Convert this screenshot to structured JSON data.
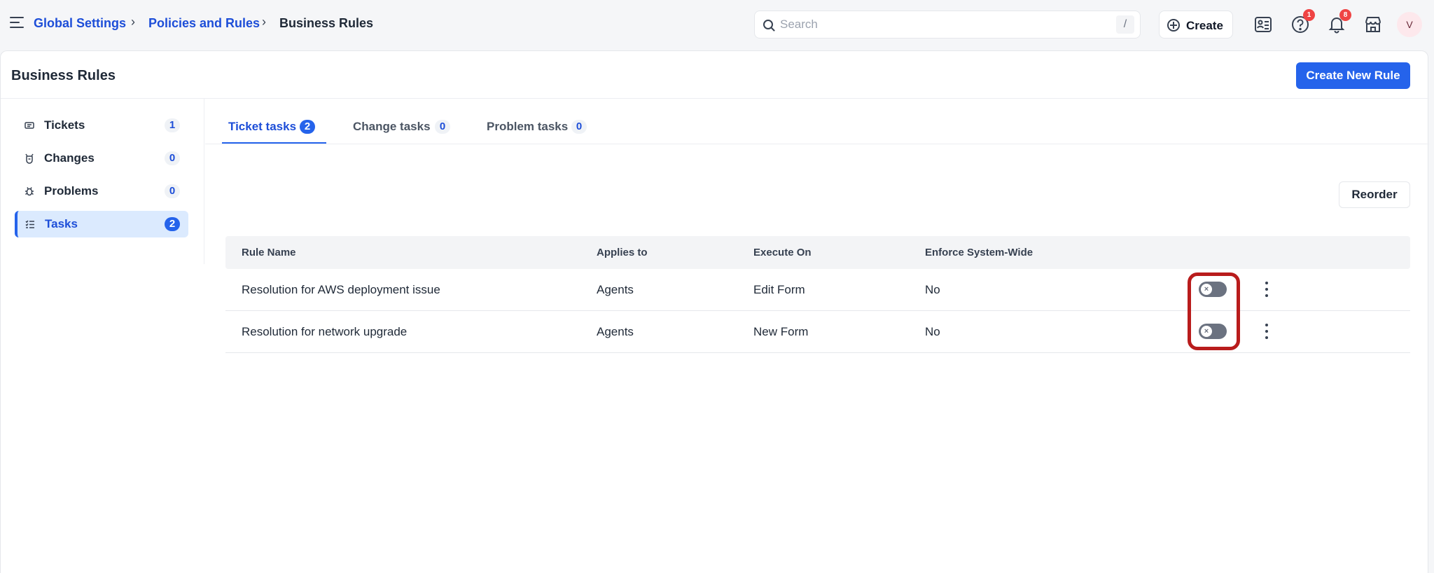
{
  "breadcrumb": {
    "items": [
      {
        "label": "Global Settings"
      },
      {
        "label": "Policies and Rules"
      },
      {
        "label": "Business Rules"
      }
    ],
    "separator": "›"
  },
  "search": {
    "placeholder": "Search",
    "shortcut": "/"
  },
  "header_actions": {
    "create_label": "Create",
    "help_badge": "1",
    "notifications_badge": "8",
    "avatar_initial": "V"
  },
  "page": {
    "title": "Business Rules",
    "primary_action": "Create New Rule"
  },
  "sidebar": {
    "items": [
      {
        "label": "Tickets",
        "count": "1",
        "icon": "ticket-icon"
      },
      {
        "label": "Changes",
        "count": "0",
        "icon": "changes-icon"
      },
      {
        "label": "Problems",
        "count": "0",
        "icon": "bug-icon"
      },
      {
        "label": "Tasks",
        "count": "2",
        "icon": "tasks-icon",
        "active": true
      }
    ]
  },
  "tabs": [
    {
      "label": "Ticket tasks",
      "count": "2",
      "active": true
    },
    {
      "label": "Change tasks",
      "count": "0"
    },
    {
      "label": "Problem tasks",
      "count": "0"
    }
  ],
  "toolbar": {
    "reorder_label": "Reorder"
  },
  "table": {
    "columns": [
      "Rule Name",
      "Applies to",
      "Execute On",
      "Enforce System-Wide"
    ],
    "rows": [
      {
        "name": "Resolution for AWS deployment issue",
        "applies_to": "Agents",
        "execute_on": "Edit Form",
        "enforce": "No",
        "enabled": false
      },
      {
        "name": "Resolution for network upgrade",
        "applies_to": "Agents",
        "execute_on": "New Form",
        "enforce": "No",
        "enabled": false
      }
    ]
  },
  "colors": {
    "accent": "#2563eb",
    "highlight": "#b91c1c",
    "badge": "#ef4444"
  }
}
